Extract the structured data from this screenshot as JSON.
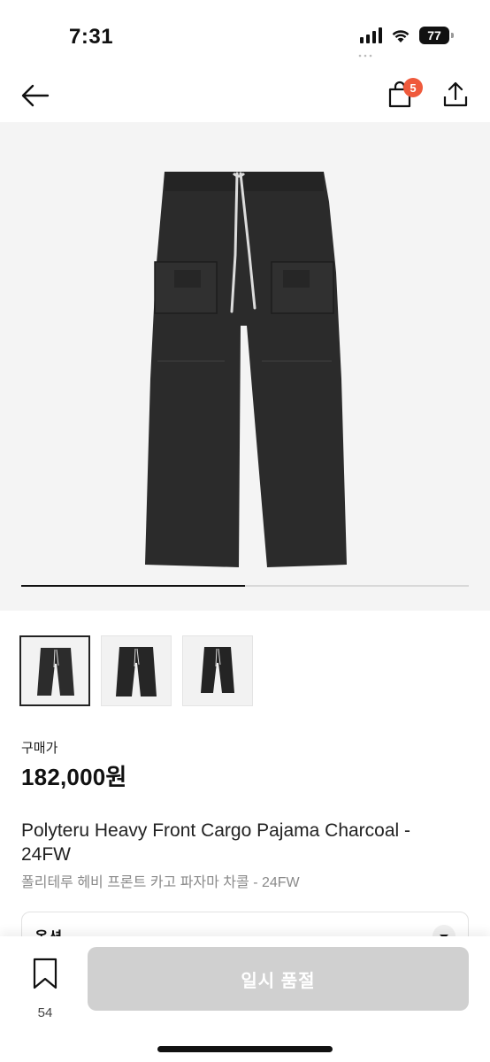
{
  "status_bar": {
    "time": "7:31",
    "battery": "77"
  },
  "nav": {
    "cart_badge": "5"
  },
  "gallery": {
    "progress": 0.5,
    "thumbnail_count": 3,
    "active_thumbnail": 1
  },
  "price": {
    "label": "구매가",
    "value": "182,000원"
  },
  "product": {
    "title_en": "Polyteru Heavy Front Cargo Pajama Charcoal - 24FW",
    "title_ko": "폴리테루 헤비 프론트 카고 파자마 차콜 - 24FW"
  },
  "option": {
    "label": "옵션"
  },
  "bottom": {
    "bookmark_count": "54",
    "cta_label": "일시 품절"
  },
  "colors": {
    "badge": "#ef5a3c",
    "cta_disabled": "#d0d0d0",
    "hero_bg": "#f4f4f4"
  },
  "icons": [
    "back-arrow-icon",
    "shopping-bag-icon",
    "share-icon",
    "bookmark-icon",
    "chevron-down-icon",
    "wifi-icon",
    "signal-icon",
    "battery-icon"
  ]
}
